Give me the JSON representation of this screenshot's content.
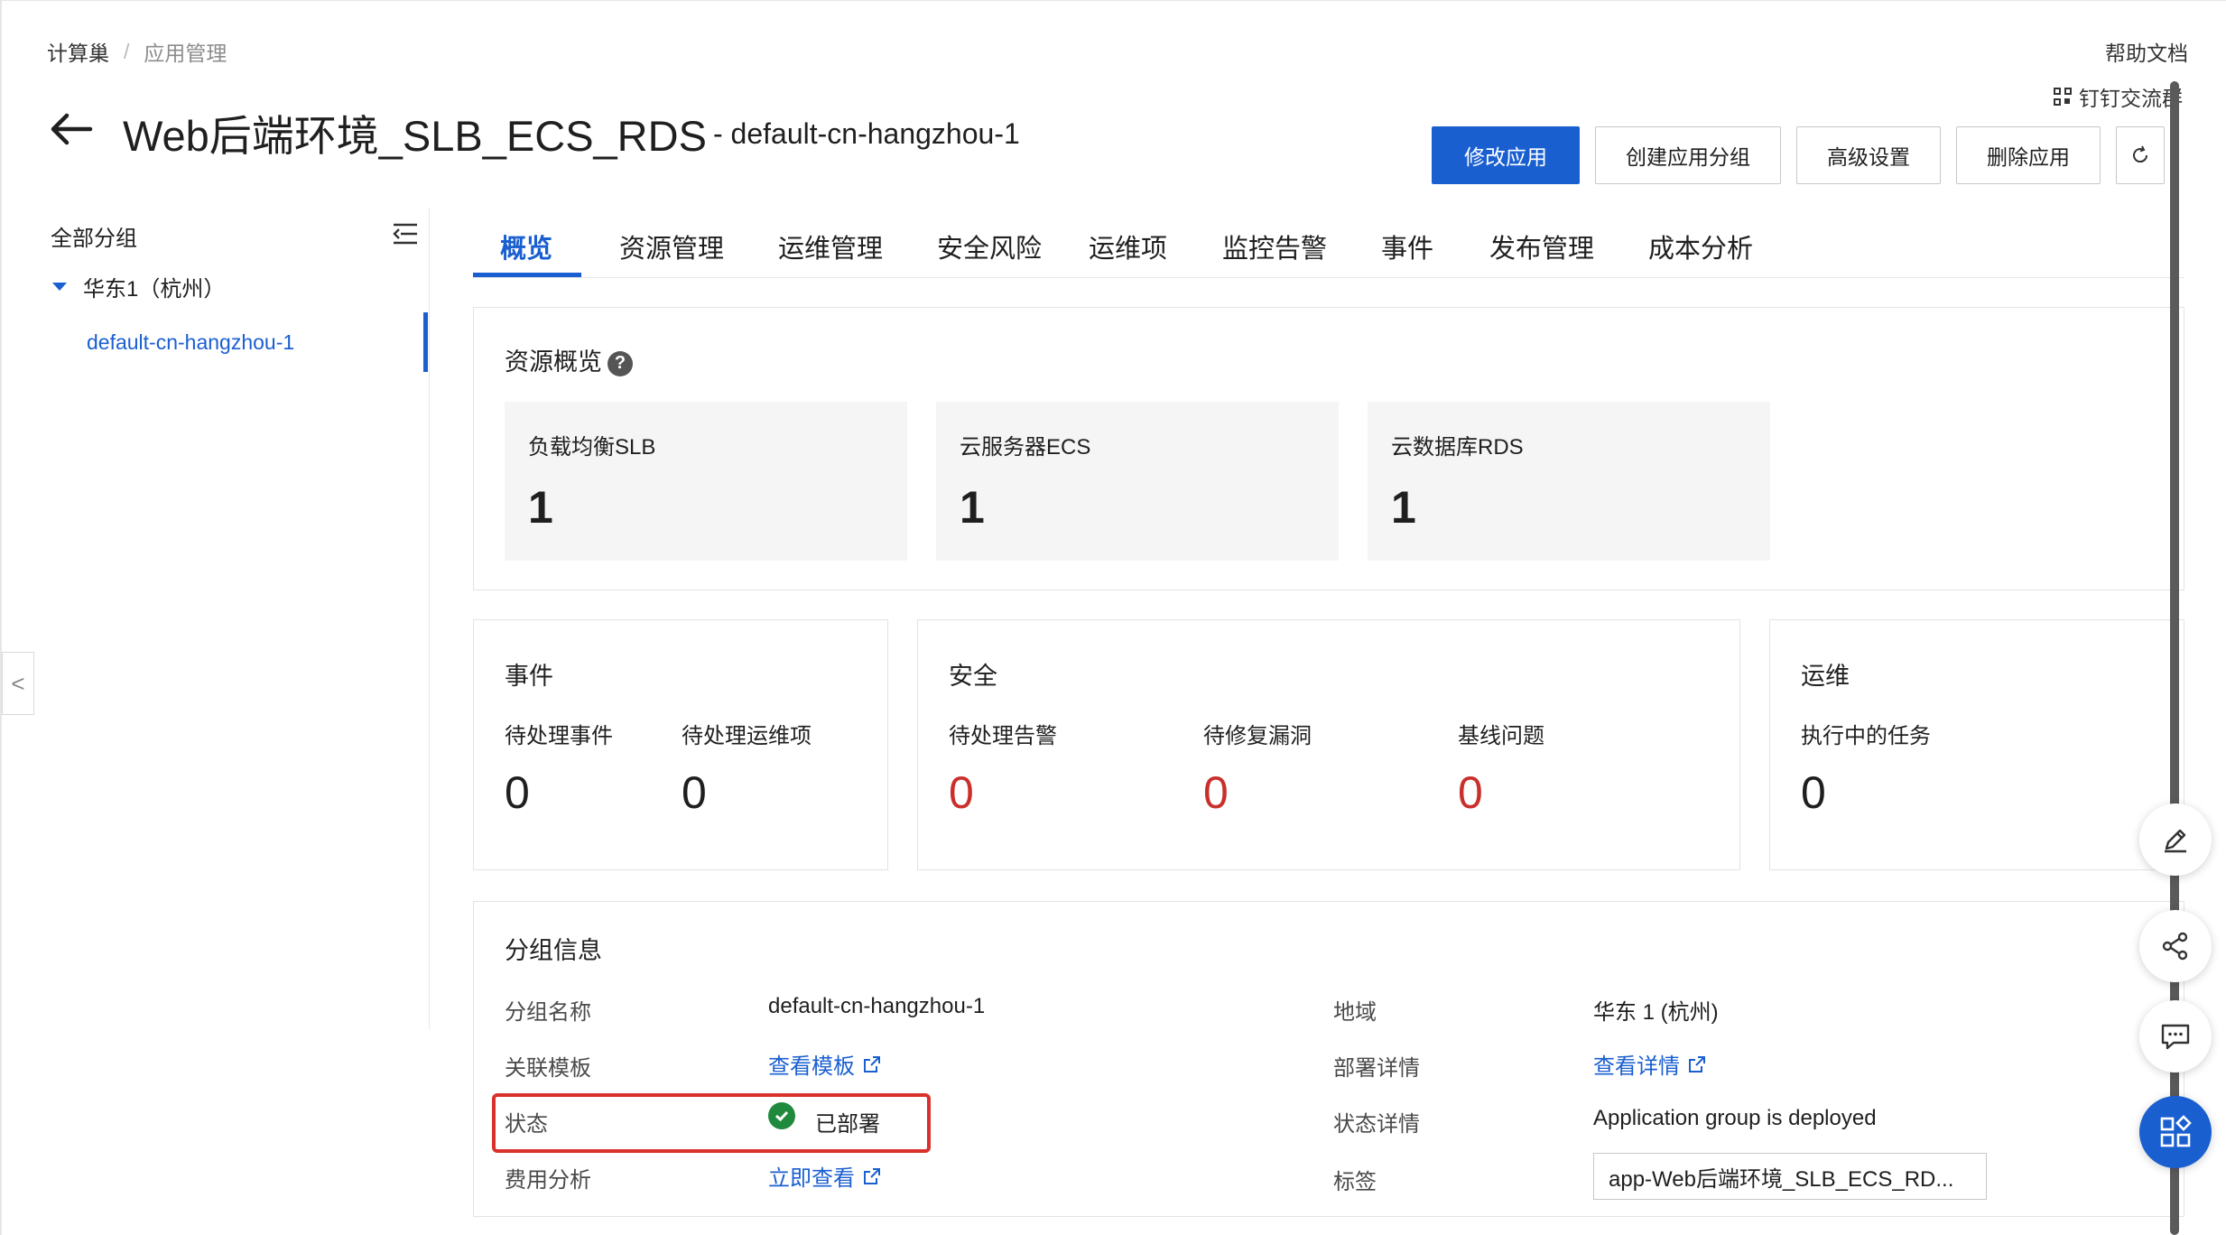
{
  "breadcrumb": {
    "root": "计算巢",
    "separator": "/",
    "current": "应用管理"
  },
  "top_links": {
    "help_doc": "帮助文档",
    "dingtalk": "钉钉交流群"
  },
  "header": {
    "title": "Web后端环境_SLB_ECS_RDS",
    "subtitle": "- default-cn-hangzhou-1"
  },
  "actions": {
    "modify": "修改应用",
    "create_group": "创建应用分组",
    "advanced": "高级设置",
    "delete": "删除应用"
  },
  "sidebar": {
    "header": "全部分组",
    "group": "华东1（杭州）",
    "item": "default-cn-hangzhou-1",
    "handle": "<"
  },
  "tabs": [
    "概览",
    "资源管理",
    "运维管理",
    "安全风险",
    "运维项",
    "监控告警",
    "事件",
    "发布管理",
    "成本分析"
  ],
  "resource_overview": {
    "title": "资源概览",
    "help": "?",
    "items": [
      {
        "label": "负载均衡SLB",
        "value": "1"
      },
      {
        "label": "云服务器ECS",
        "value": "1"
      },
      {
        "label": "云数据库RDS",
        "value": "1"
      }
    ]
  },
  "events": {
    "title": "事件",
    "metrics": [
      {
        "label": "待处理事件",
        "value": "0"
      },
      {
        "label": "待处理运维项",
        "value": "0"
      }
    ]
  },
  "security": {
    "title": "安全",
    "metrics": [
      {
        "label": "待处理告警",
        "value": "0"
      },
      {
        "label": "待修复漏洞",
        "value": "0"
      },
      {
        "label": "基线问题",
        "value": "0"
      }
    ]
  },
  "ops": {
    "title": "运维",
    "metrics": [
      {
        "label": "执行中的任务",
        "value": "0"
      }
    ]
  },
  "group_info": {
    "title": "分组信息",
    "group_name_label": "分组名称",
    "group_name_value": "default-cn-hangzhou-1",
    "template_label": "关联模板",
    "template_link": "查看模板",
    "status_label": "状态",
    "status_value": "已部署",
    "cost_label": "费用分析",
    "cost_link": "立即查看",
    "region_label": "地域",
    "region_value": "华东 1 (杭州)",
    "deploy_label": "部署详情",
    "deploy_link": "查看详情",
    "status_detail_label": "状态详情",
    "status_detail_value": "Application group is deployed",
    "tag_label": "标签",
    "tag_value": "app-Web后端环境_SLB_ECS_RD..."
  },
  "colors": {
    "primary": "#1a5fd0",
    "danger": "#c9302c",
    "success": "#1f8a3d",
    "highlight": "#d9312b"
  }
}
